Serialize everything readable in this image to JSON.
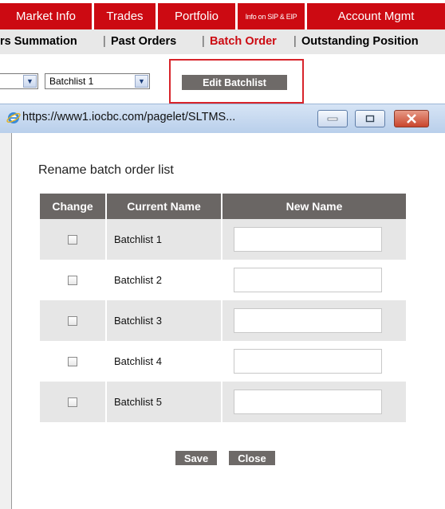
{
  "nav": {
    "tabs": [
      {
        "label": "Market Info"
      },
      {
        "label": "Trades"
      },
      {
        "label": "Portfolio"
      },
      {
        "label": "Info on SIP & EIP"
      },
      {
        "label": "Account Mgmt"
      }
    ]
  },
  "subnav": {
    "items": [
      {
        "label": "rs Summation"
      },
      {
        "label": "Past Orders"
      },
      {
        "label": "Batch Order"
      },
      {
        "label": "Outstanding Position"
      }
    ],
    "separator": "|"
  },
  "toolbar": {
    "batchlist_select_value": "Batchlist 1",
    "edit_button_label": "Edit Batchlist"
  },
  "popup": {
    "url": "https://www1.iocbc.com/pagelet/SLTMS...",
    "title": "Rename batch order list",
    "columns": [
      "Change",
      "Current Name",
      "New Name"
    ],
    "rows": [
      {
        "current_name": "Batchlist 1",
        "new_name": "",
        "checked": false
      },
      {
        "current_name": "Batchlist 2",
        "new_name": "",
        "checked": false
      },
      {
        "current_name": "Batchlist 3",
        "new_name": "",
        "checked": false
      },
      {
        "current_name": "Batchlist 4",
        "new_name": "",
        "checked": false
      },
      {
        "current_name": "Batchlist 5",
        "new_name": "",
        "checked": false
      }
    ],
    "save_label": "Save",
    "close_label": "Close"
  },
  "colors": {
    "brand_red": "#cc0a12",
    "header_gray": "#6a6664",
    "highlight_red": "#d8242b"
  }
}
